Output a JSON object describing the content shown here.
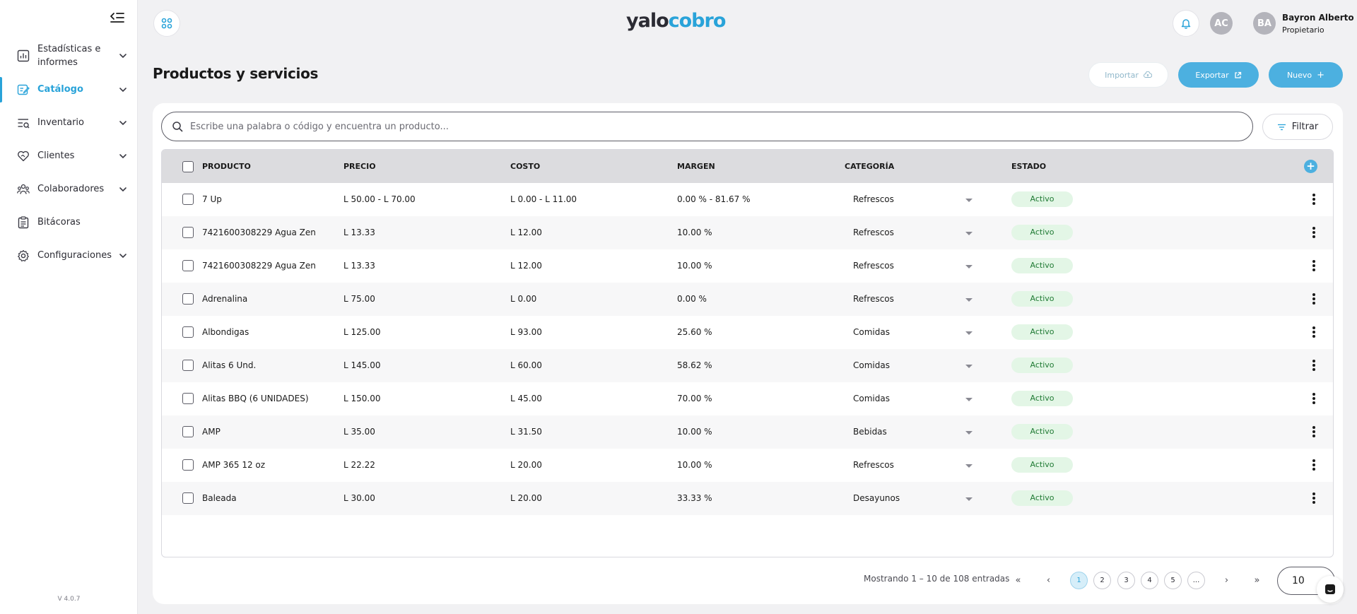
{
  "brand": {
    "logo_part1": "yalo",
    "logo_part2": "cobro",
    "accent": "#29a3d9",
    "button_color": "#4cb0e0"
  },
  "sidebar": {
    "version": "V 4.0.7",
    "items": [
      {
        "label": "Estadísticas e informes",
        "icon": "chart-icon",
        "expandable": true,
        "active": false
      },
      {
        "label": "Catálogo",
        "icon": "catalog-edit-icon",
        "expandable": true,
        "active": true
      },
      {
        "label": "Inventario",
        "icon": "inventory-icon",
        "expandable": true,
        "active": false
      },
      {
        "label": "Clientes",
        "icon": "handshake-heart-icon",
        "expandable": true,
        "active": false
      },
      {
        "label": "Colaboradores",
        "icon": "people-icon",
        "expandable": true,
        "active": false
      },
      {
        "label": "Bitácoras",
        "icon": "clipboard-icon",
        "expandable": false,
        "active": false
      },
      {
        "label": "Configuraciones",
        "icon": "gear-icon",
        "expandable": true,
        "active": false
      }
    ]
  },
  "header": {
    "avatar_initials": "AC",
    "user_initials": "BA",
    "user_name": "Bayron Alberto",
    "user_role": "Propietario"
  },
  "page": {
    "title": "Productos y servicios",
    "import_label": "Importar",
    "export_label": "Exportar",
    "new_label": "Nuevo",
    "new_icon": "+"
  },
  "search": {
    "placeholder": "Escribe una palabra o código y encuentra un producto...",
    "value": ""
  },
  "filter_label": "Filtrar",
  "table": {
    "columns": [
      "PRODUCTO",
      "PRECIO",
      "COSTO",
      "MARGEN",
      "CATEGORÍA",
      "ESTADO"
    ],
    "add_column_icon": "+",
    "rows": [
      {
        "producto": "7 Up",
        "precio": "L 50.00 - L 70.00",
        "costo": "L 0.00 - L 11.00",
        "margen": "0.00 % - 81.67 %",
        "categoria": "Refrescos",
        "estado": "Activo"
      },
      {
        "producto": "7421600308229 Agua Zen",
        "precio": "L 13.33",
        "costo": "L 12.00",
        "margen": "10.00 %",
        "categoria": "Refrescos",
        "estado": "Activo"
      },
      {
        "producto": "7421600308229 Agua Zen",
        "precio": "L 13.33",
        "costo": "L 12.00",
        "margen": "10.00 %",
        "categoria": "Refrescos",
        "estado": "Activo"
      },
      {
        "producto": "Adrenalina",
        "precio": "L 75.00",
        "costo": "L 0.00",
        "margen": "0.00 %",
        "categoria": "Refrescos",
        "estado": "Activo"
      },
      {
        "producto": "Albondigas",
        "precio": "L 125.00",
        "costo": "L 93.00",
        "margen": "25.60 %",
        "categoria": "Comidas",
        "estado": "Activo"
      },
      {
        "producto": "Alitas 6 Und.",
        "precio": "L 145.00",
        "costo": "L 60.00",
        "margen": "58.62 %",
        "categoria": "Comidas",
        "estado": "Activo"
      },
      {
        "producto": "Alitas BBQ (6 UNIDADES)",
        "precio": "L 150.00",
        "costo": "L 45.00",
        "margen": "70.00 %",
        "categoria": "Comidas",
        "estado": "Activo"
      },
      {
        "producto": "AMP",
        "precio": "L 35.00",
        "costo": "L 31.50",
        "margen": "10.00 %",
        "categoria": "Bebidas",
        "estado": "Activo"
      },
      {
        "producto": "AMP 365 12 oz",
        "precio": "L 22.22",
        "costo": "L 20.00",
        "margen": "10.00 %",
        "categoria": "Refrescos",
        "estado": "Activo"
      },
      {
        "producto": "Baleada",
        "precio": "L 30.00",
        "costo": "L 20.00",
        "margen": "33.33 %",
        "categoria": "Desayunos",
        "estado": "Activo"
      }
    ]
  },
  "pagination": {
    "info": "Mostrando 1 – 10 de 108 entradas",
    "first": "«",
    "prev": "‹",
    "pages": [
      "1",
      "2",
      "3",
      "4",
      "5",
      "..."
    ],
    "current": "1",
    "next": "›",
    "last": "»",
    "per_page": "10"
  }
}
